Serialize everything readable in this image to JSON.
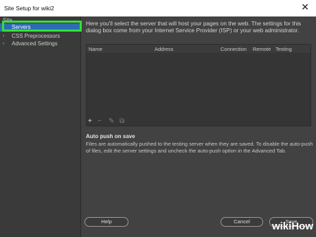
{
  "window": {
    "title": "Site Setup for wiki2",
    "close_icon": "close-icon"
  },
  "sidebar": {
    "items": [
      {
        "label": "Site",
        "expandable": false
      },
      {
        "label": "Servers",
        "expandable": false,
        "selected": true
      },
      {
        "label": "CSS Preprocessors",
        "expandable": true
      },
      {
        "label": "Advanced Settings",
        "expandable": true
      }
    ]
  },
  "main": {
    "intro": "Here you'll select the server that will host your pages on the web. The settings for this dialog box come from your Internet Service Provider (ISP) or your web administrator.",
    "table": {
      "columns": [
        "Name",
        "Address",
        "Connection",
        "Remote",
        "Testing"
      ],
      "rows": []
    },
    "tools": {
      "add": "+",
      "remove": "−",
      "edit": "✎",
      "duplicate": "⧉"
    },
    "auto_push": {
      "title": "Auto push on save",
      "text": "Files are automatically pushed to the testing server when they are saved. To disable the auto-push of files, edit the server settings and uncheck the auto-push option in the Advanced Tab."
    }
  },
  "footer": {
    "help": "Help",
    "cancel": "Cancel",
    "save": "Save"
  },
  "watermark": {
    "part1": "wiki",
    "part2": "How"
  },
  "colors": {
    "selected": "#2d6bb5",
    "highlight": "#34e23a",
    "panel": "#424242",
    "sidebar": "#3a3a3a"
  }
}
